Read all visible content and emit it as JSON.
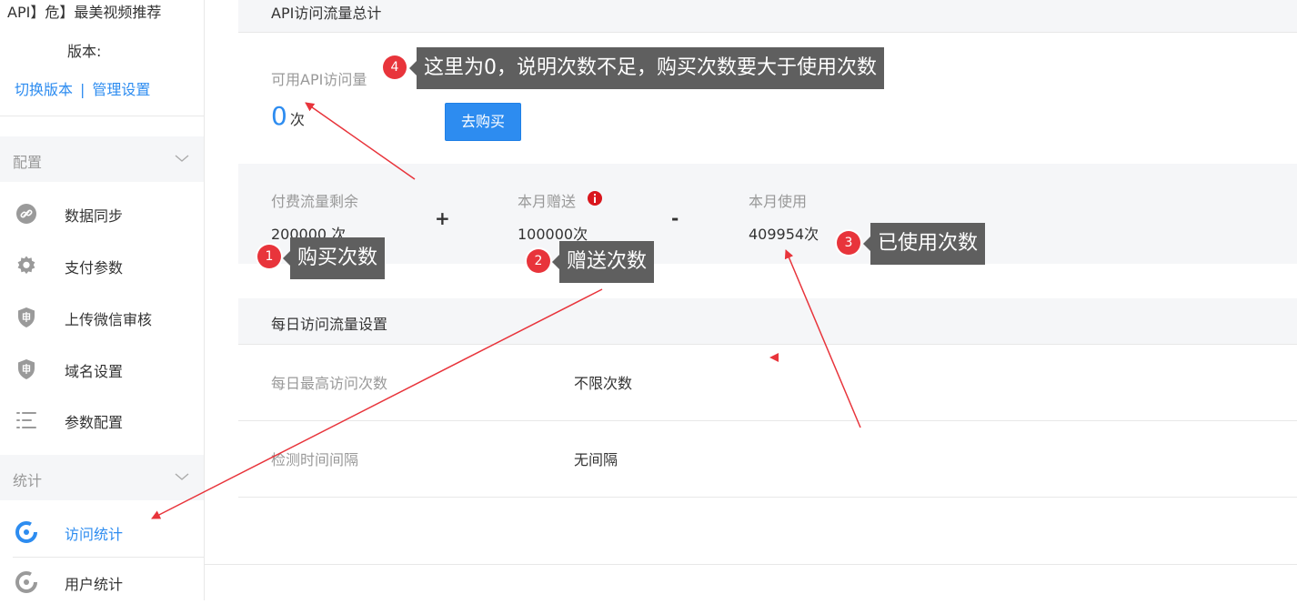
{
  "sidebar": {
    "app_title": "API】危】最美视频推荐",
    "version_label": "版本:",
    "switch_version": "切换版本",
    "link_separator": "|",
    "manage_settings": "管理设置",
    "groups": [
      {
        "label": "配置",
        "items": [
          {
            "label": "数据同步",
            "icon": "link-icon"
          },
          {
            "label": "支付参数",
            "icon": "gear-icon"
          },
          {
            "label": "上传微信审核",
            "icon": "shield-icon"
          },
          {
            "label": "域名设置",
            "icon": "shield-icon"
          },
          {
            "label": "参数配置",
            "icon": "list-settings-icon"
          }
        ]
      },
      {
        "label": "统计",
        "items": [
          {
            "label": "访问统计",
            "icon": "pie-chart-icon",
            "active": true
          },
          {
            "label": "用户统计",
            "icon": "pie-chart-icon"
          }
        ]
      }
    ]
  },
  "main": {
    "section_title": "API访问流量总计",
    "available_label": "可用API访问量",
    "available_value": "0",
    "available_unit": "次",
    "buy_button": "去购买",
    "stats": {
      "paid_label": "付费流量剩余",
      "paid_value": "200000 次",
      "plus": "+",
      "gift_label": "本月赠送",
      "gift_value": "100000次",
      "minus": "-",
      "used_label": "本月使用",
      "used_value": "409954次"
    },
    "daily_section_title": "每日访问流量设置",
    "settings_rows": [
      {
        "key": "每日最高访问次数",
        "value": "不限次数"
      },
      {
        "key": "检测时间间隔",
        "value": "无间隔"
      }
    ]
  },
  "annotations": [
    {
      "number": "1",
      "text": "购买次数"
    },
    {
      "number": "2",
      "text": "赠送次数"
    },
    {
      "number": "3",
      "text": "已使用次数"
    },
    {
      "number": "4",
      "text": "这里为0，说明次数不足，购买次数要大于使用次数"
    }
  ],
  "colors": {
    "accent": "#2d8cf0",
    "annotation_red": "#e8343b",
    "bubble_bg": "#5f5f5f",
    "section_bg": "#f5f6f8"
  }
}
